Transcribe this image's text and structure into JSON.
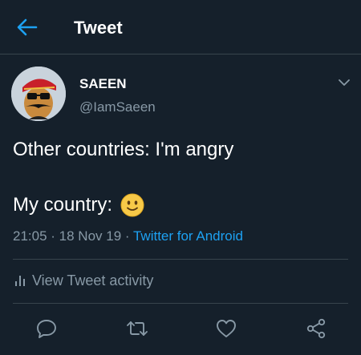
{
  "header": {
    "title": "Tweet",
    "back_icon": "back-arrow-icon"
  },
  "tweet": {
    "author_name": "SAEEN",
    "handle": "@IamSaeen",
    "text_line1": "Other countries: I'm angry",
    "text_line2": "My country:",
    "emoji": "slightly-smiling-face",
    "time": "21:05",
    "separator1": " · ",
    "date": "18 Nov 19",
    "separator2": " · ",
    "source": "Twitter for Android"
  },
  "activity": {
    "label": "View Tweet activity"
  },
  "actions": [
    "reply-icon",
    "retweet-icon",
    "like-icon",
    "share-icon"
  ],
  "colors": {
    "background": "#15202b",
    "accent": "#1da1f2",
    "secondary_text": "#8899a6",
    "divider": "#38444d"
  }
}
